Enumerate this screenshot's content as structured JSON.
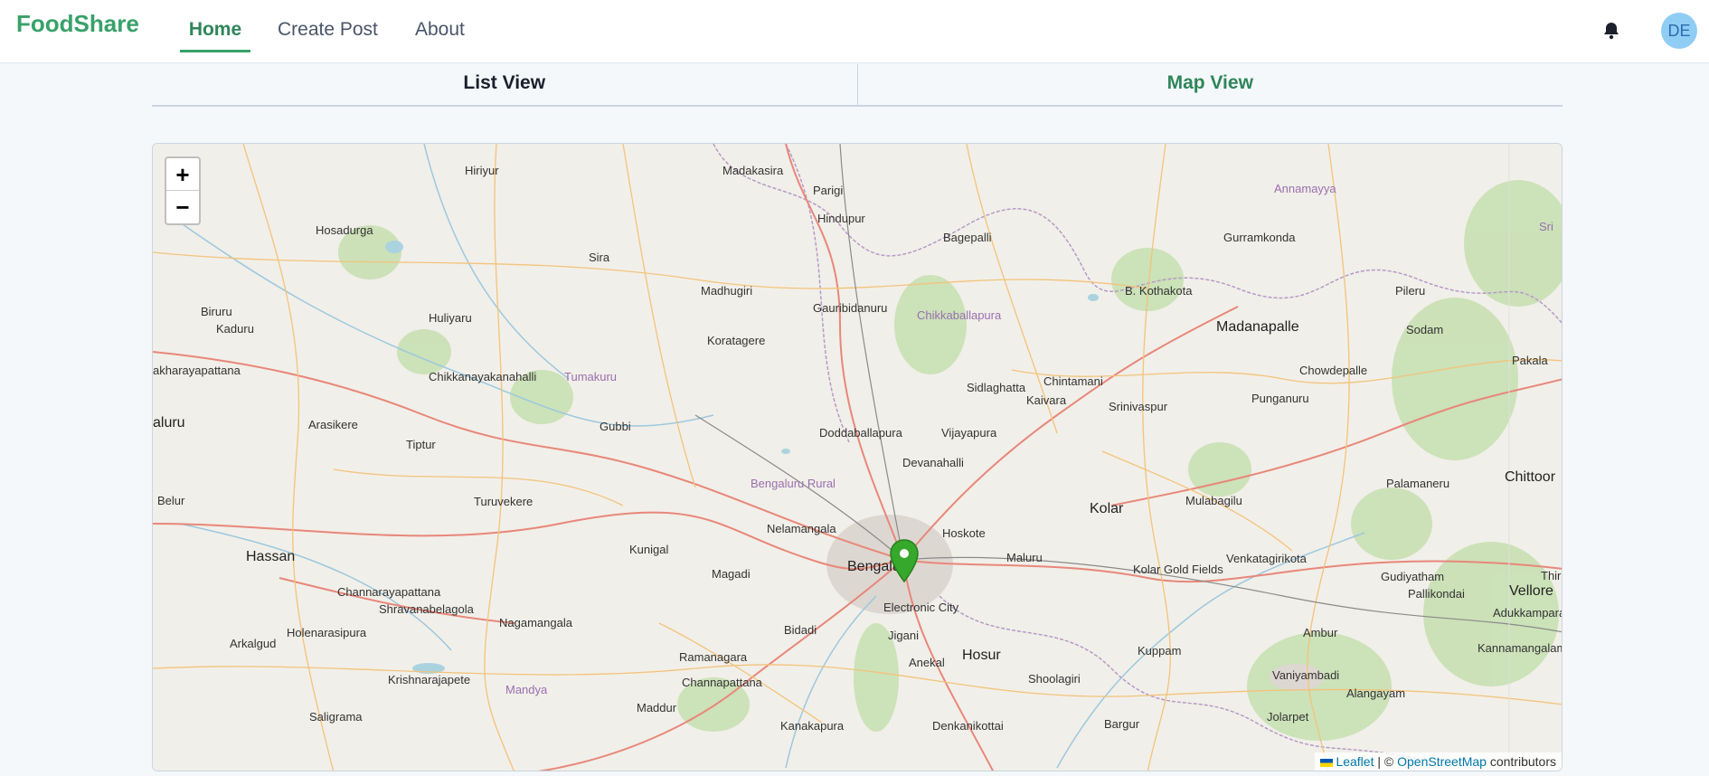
{
  "nav": {
    "brand": "FoodShare",
    "links": [
      "Home",
      "Create Post",
      "About"
    ],
    "active": "Home",
    "avatar": "DE"
  },
  "tabs": [
    "List View",
    "Map View"
  ],
  "map": {
    "zoom_in": "+",
    "zoom_out": "−",
    "attribution": {
      "leaflet": "Leaflet",
      "sep": " | © ",
      "osm": "OpenStreetMap",
      "tail": " contributors"
    },
    "places": [
      "Madakasira",
      "Parigi",
      "Hiriyur",
      "Hindupur",
      "Bagepalli",
      "Gurramkonda",
      "Annamayya",
      "Hosadurga",
      "Sira",
      "Madhugiri",
      "B. Kothakota",
      "Pileru",
      "Biruru",
      "Kaduru",
      "Huliyaru",
      "Gauribidanuru",
      "Chikkaballapura",
      "Madanapalle",
      "Sodam",
      "Koratagere",
      "Pakala",
      "akharayapattana",
      "Chikkanayakanahalli",
      "Tumakuru",
      "Chowdepalle",
      "Sidlaghatta",
      "Chintamani",
      "Kaivara",
      "Srinivaspur",
      "Punganuru",
      "aluru",
      "Arasikere",
      "Gubbi",
      "Doddaballapura",
      "Vijayapura",
      "Tiptur",
      "Devanahalli",
      "Palamaneru",
      "Chittoor",
      "Bengaluru Rural",
      "Kolar",
      "Mulabagilu",
      "Belur",
      "Turuvekere",
      "Nelamangala",
      "Hoskote",
      "Hassan",
      "Kunigal",
      "Magadi",
      "Bengaluru",
      "Maluru",
      "Venkatagirikota",
      "Kolar Gold Fields",
      "Gudiyatham",
      "Pallikondai",
      "Vellore",
      "Channarayapattana",
      "Shravanabelagola",
      "Electronic City",
      "Adukkamparai",
      "Nagamangala",
      "Bidadi",
      "Jigani",
      "Arkalgud",
      "Holenarasipura",
      "Ambur",
      "Kannamangalam",
      "Ramanagara",
      "Anekal",
      "Hosur",
      "Kuppam",
      "Krishnarajapete",
      "Channapattana",
      "Shoolagiri",
      "Vaniyambadi",
      "Mandya",
      "Alangayam",
      "Maddur",
      "Saligrama",
      "Kanakapura",
      "Denkanikottai",
      "Bargur",
      "Jolarpet",
      "Sri",
      "Thir",
      "Chikkaballapura",
      "Kolar"
    ]
  }
}
